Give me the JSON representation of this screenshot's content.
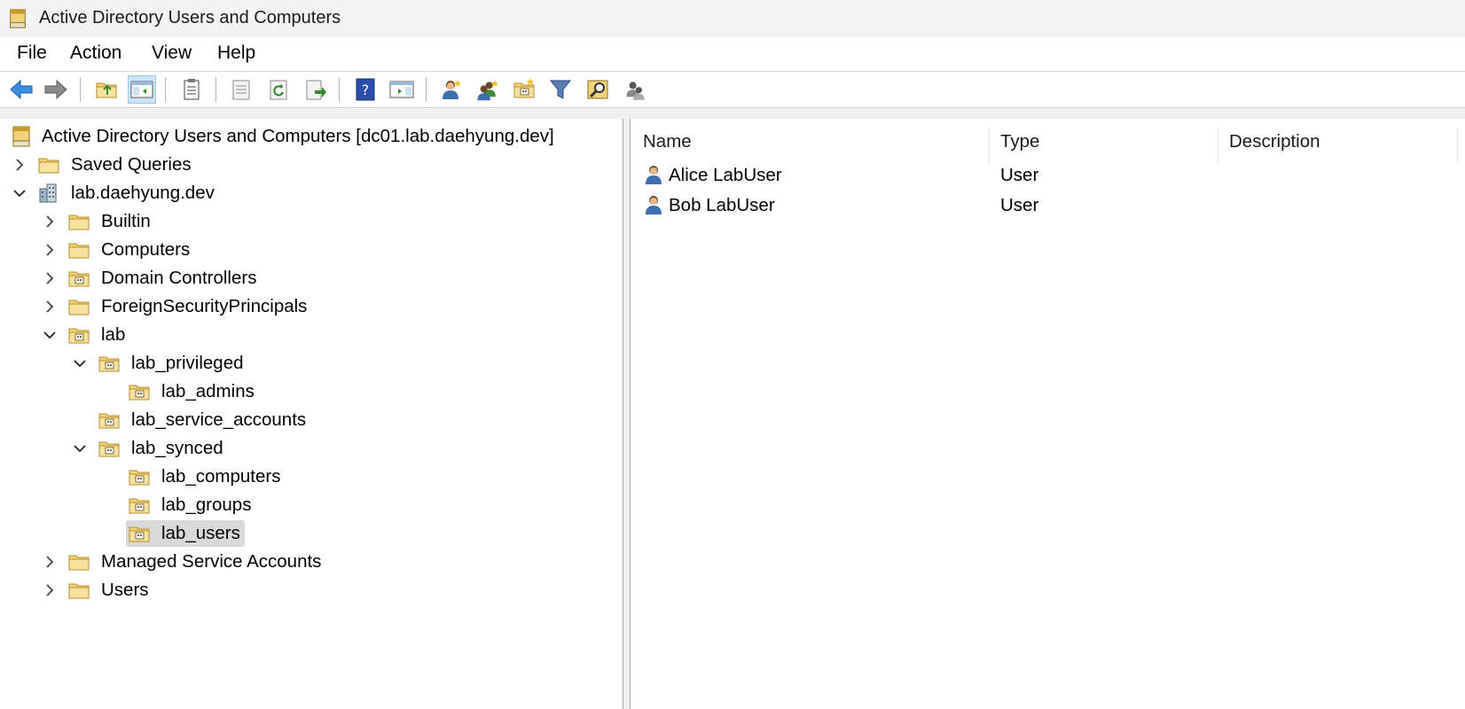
{
  "window": {
    "title": "Active Directory Users and Computers"
  },
  "menu": [
    "File",
    "Action",
    "View",
    "Help"
  ],
  "toolbar": {
    "buttons": [
      "back-icon",
      "forward-icon",
      "up-folder-icon",
      "show-hide-tree-icon",
      "clipboard-icon",
      "properties-icon",
      "refresh-icon",
      "export-list-icon",
      "help-icon",
      "action-pane-icon",
      "new-user-icon",
      "new-group-icon",
      "new-ou-icon",
      "filter-icon",
      "find-icon",
      "delegate-icon"
    ]
  },
  "tree": {
    "root": "Active Directory Users and Computers [dc01.lab.daehyung.dev]",
    "items": [
      {
        "label": "Saved Queries",
        "icon": "folder-icon",
        "state": "collapsed"
      },
      {
        "label": "lab.daehyung.dev",
        "icon": "domain-icon",
        "state": "expanded"
      },
      {
        "label": "Builtin",
        "icon": "folder-icon",
        "state": "collapsed"
      },
      {
        "label": "Computers",
        "icon": "folder-icon",
        "state": "collapsed"
      },
      {
        "label": "Domain Controllers",
        "icon": "ou-icon",
        "state": "collapsed"
      },
      {
        "label": "ForeignSecurityPrincipals",
        "icon": "folder-icon",
        "state": "collapsed"
      },
      {
        "label": "lab",
        "icon": "ou-icon",
        "state": "expanded"
      },
      {
        "label": "lab_privileged",
        "icon": "ou-icon",
        "state": "expanded"
      },
      {
        "label": "lab_admins",
        "icon": "ou-icon",
        "state": "leaf"
      },
      {
        "label": "lab_service_accounts",
        "icon": "ou-icon",
        "state": "leaf"
      },
      {
        "label": "lab_synced",
        "icon": "ou-icon",
        "state": "expanded"
      },
      {
        "label": "lab_computers",
        "icon": "ou-icon",
        "state": "leaf"
      },
      {
        "label": "lab_groups",
        "icon": "ou-icon",
        "state": "leaf"
      },
      {
        "label": "lab_users",
        "icon": "ou-icon",
        "state": "selected"
      },
      {
        "label": "Managed Service Accounts",
        "icon": "folder-icon",
        "state": "collapsed"
      },
      {
        "label": "Users",
        "icon": "folder-icon",
        "state": "collapsed"
      }
    ]
  },
  "list": {
    "columns": [
      "Name",
      "Type",
      "Description"
    ],
    "rows": [
      {
        "name": "Alice LabUser",
        "type": "User",
        "description": ""
      },
      {
        "name": "Bob LabUser",
        "type": "User",
        "description": ""
      }
    ]
  }
}
